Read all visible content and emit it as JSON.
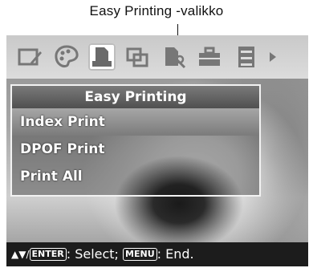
{
  "callout": {
    "label": "Easy Printing -valikko"
  },
  "toolbar": {
    "items": [
      {
        "icon": "edit-icon"
      },
      {
        "icon": "palette-icon"
      },
      {
        "icon": "print-icon",
        "selected": true
      },
      {
        "icon": "layout-icon"
      },
      {
        "icon": "print-settings-icon"
      },
      {
        "icon": "toolbox-icon"
      },
      {
        "icon": "cabinet-icon"
      },
      {
        "icon": "more-arrow-icon"
      }
    ]
  },
  "menu": {
    "title": "Easy Printing",
    "items": [
      {
        "label": "Index Print",
        "selected": true
      },
      {
        "label": "DPOF Print",
        "selected": false
      },
      {
        "label": "Print All",
        "selected": false
      }
    ]
  },
  "status_bar": {
    "arrows": "▲▼/",
    "enter_key": "ENTER",
    "select_text": ": Select; ",
    "menu_key": "MENU",
    "end_text": ": End."
  },
  "colors": {
    "menu_header": "#5c5c5c",
    "selected_item": "#8f8f8f",
    "status_bar": "#1c1c1c"
  }
}
